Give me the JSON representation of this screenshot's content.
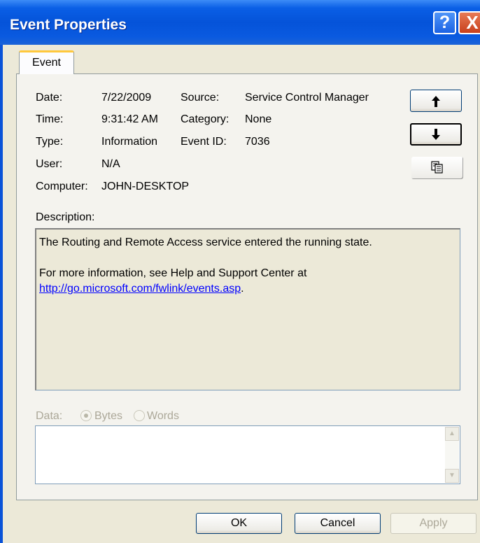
{
  "window": {
    "title": "Event Properties"
  },
  "titlebar": {
    "help_symbol": "?",
    "close_symbol": "X"
  },
  "tabs": [
    {
      "label": "Event",
      "active": true
    }
  ],
  "fields": {
    "date_label": "Date:",
    "date_value": "7/22/2009",
    "source_label": "Source:",
    "source_value": "Service Control Manager",
    "time_label": "Time:",
    "time_value": "9:31:42 AM",
    "category_label": "Category:",
    "category_value": "None",
    "type_label": "Type:",
    "type_value": "Information",
    "event_id_label": "Event ID:",
    "event_id_value": "7036",
    "user_label": "User:",
    "user_value": "N/A",
    "computer_label": "Computer:",
    "computer_value": "JOHN-DESKTOP"
  },
  "nav_buttons": {
    "up_icon": "arrow-up-icon",
    "down_icon": "arrow-down-icon",
    "copy_icon": "copy-icon"
  },
  "description": {
    "label": "Description:",
    "line1": "The Routing and Remote Access service entered the running state.",
    "line2": "For more information, see Help and Support Center at",
    "link": "http://go.microsoft.com/fwlink/events.asp",
    "link_suffix": "."
  },
  "data_section": {
    "label": "Data:",
    "options": [
      "Bytes",
      "Words"
    ],
    "selected": "Bytes"
  },
  "buttons": {
    "ok": "OK",
    "cancel": "Cancel",
    "apply": "Apply"
  },
  "colors": {
    "titlebar": "#0553d9",
    "dialog_bg": "#ece9d8",
    "link": "#0000ff",
    "tab_highlight": "#ffc83c"
  }
}
